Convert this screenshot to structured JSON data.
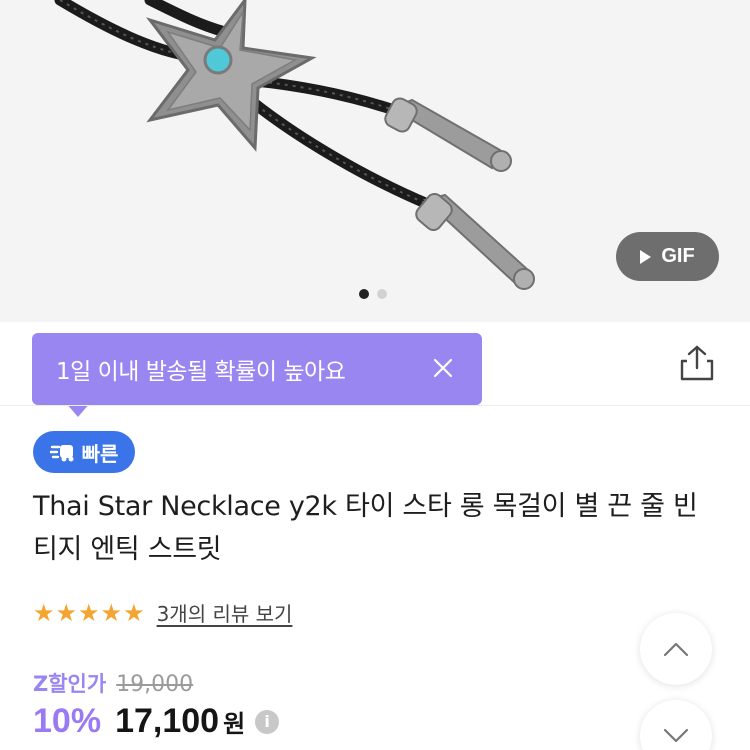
{
  "product_image": {
    "gif_label": "GIF",
    "carousel": {
      "total": 2,
      "active": 0
    }
  },
  "tooltip": {
    "text": "1일 이내 발송될 확률이 높아요",
    "close_icon": "close-icon"
  },
  "share_icon": "share-icon",
  "badge": {
    "label": "빠른",
    "icon": "fast-delivery-icon",
    "color": "#3b73e8"
  },
  "product": {
    "title": "Thai Star Necklace y2k 타이 스타 롱 목걸이 별 끈 줄 빈티지 엔틱 스트릿"
  },
  "rating": {
    "stars": 5,
    "review_link": "3개의 리뷰 보기"
  },
  "price": {
    "label": "Z할인가",
    "original": "19,000",
    "discount": "10%",
    "final": "17,100",
    "currency": "원",
    "info_icon": "info-icon"
  },
  "colors": {
    "accent": "#9a86f0",
    "star": "#f4a531"
  }
}
